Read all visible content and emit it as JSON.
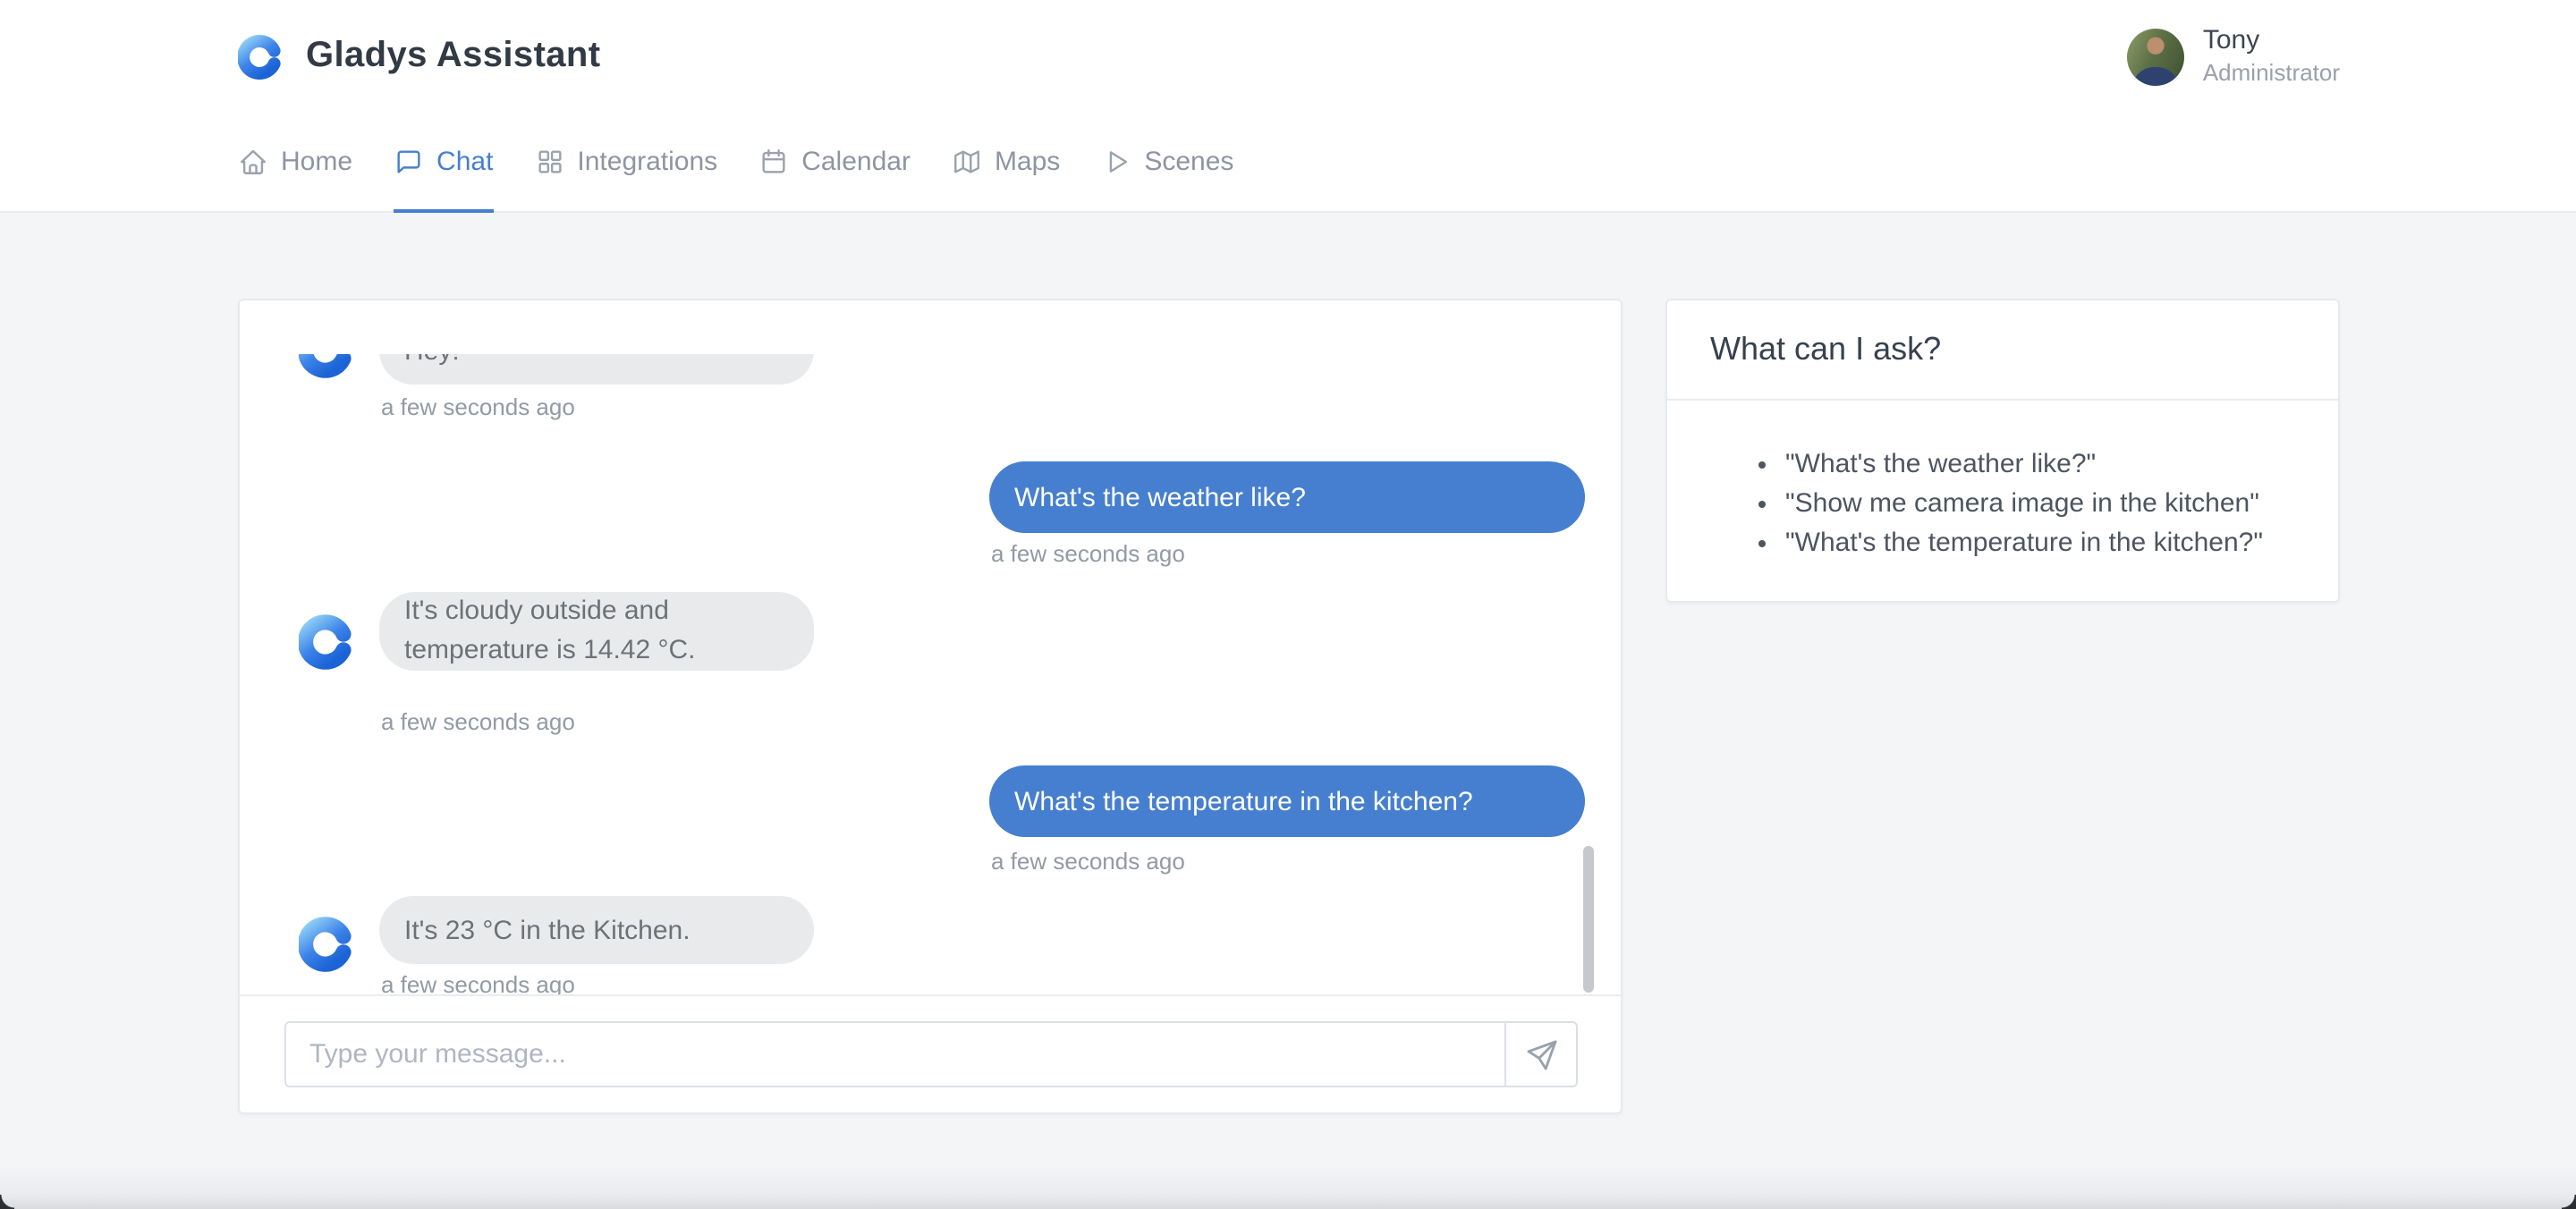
{
  "header": {
    "app_title": "Gladys Assistant",
    "user": {
      "name": "Tony",
      "role": "Administrator"
    }
  },
  "nav": {
    "items": [
      {
        "label": "Home",
        "icon": "home-icon",
        "active": false
      },
      {
        "label": "Chat",
        "icon": "chat-icon",
        "active": true
      },
      {
        "label": "Integrations",
        "icon": "apps-icon",
        "active": false
      },
      {
        "label": "Calendar",
        "icon": "calendar-icon",
        "active": false
      },
      {
        "label": "Maps",
        "icon": "map-icon",
        "active": false
      },
      {
        "label": "Scenes",
        "icon": "scenes-icon",
        "active": false
      }
    ]
  },
  "chat": {
    "messages": [
      {
        "sender": "assistant",
        "text": "Hey!",
        "time": "a few seconds ago"
      },
      {
        "sender": "user",
        "text": "What's the weather like?",
        "time": "a few seconds ago"
      },
      {
        "sender": "assistant",
        "text": "It's cloudy outside and temperature is 14.42 °C.",
        "time": "a few seconds ago"
      },
      {
        "sender": "user",
        "text": "What's the temperature in the kitchen?",
        "time": "a few seconds ago"
      },
      {
        "sender": "assistant",
        "text": "It's 23 °C in the Kitchen.",
        "time": "a few seconds ago"
      }
    ],
    "input": {
      "value": "",
      "placeholder": "Type your message..."
    },
    "send_icon": "send-icon"
  },
  "help_card": {
    "title": "What can I ask?",
    "suggestions": [
      "\"What's the weather like?\"",
      "\"Show me camera image in the kitchen\"",
      "\"What's the temperature in the kitchen?\""
    ]
  },
  "colors": {
    "accent": "#467fcf",
    "assistant_bubble": "#e9eaeb",
    "page_bg": "#f4f5f7"
  }
}
